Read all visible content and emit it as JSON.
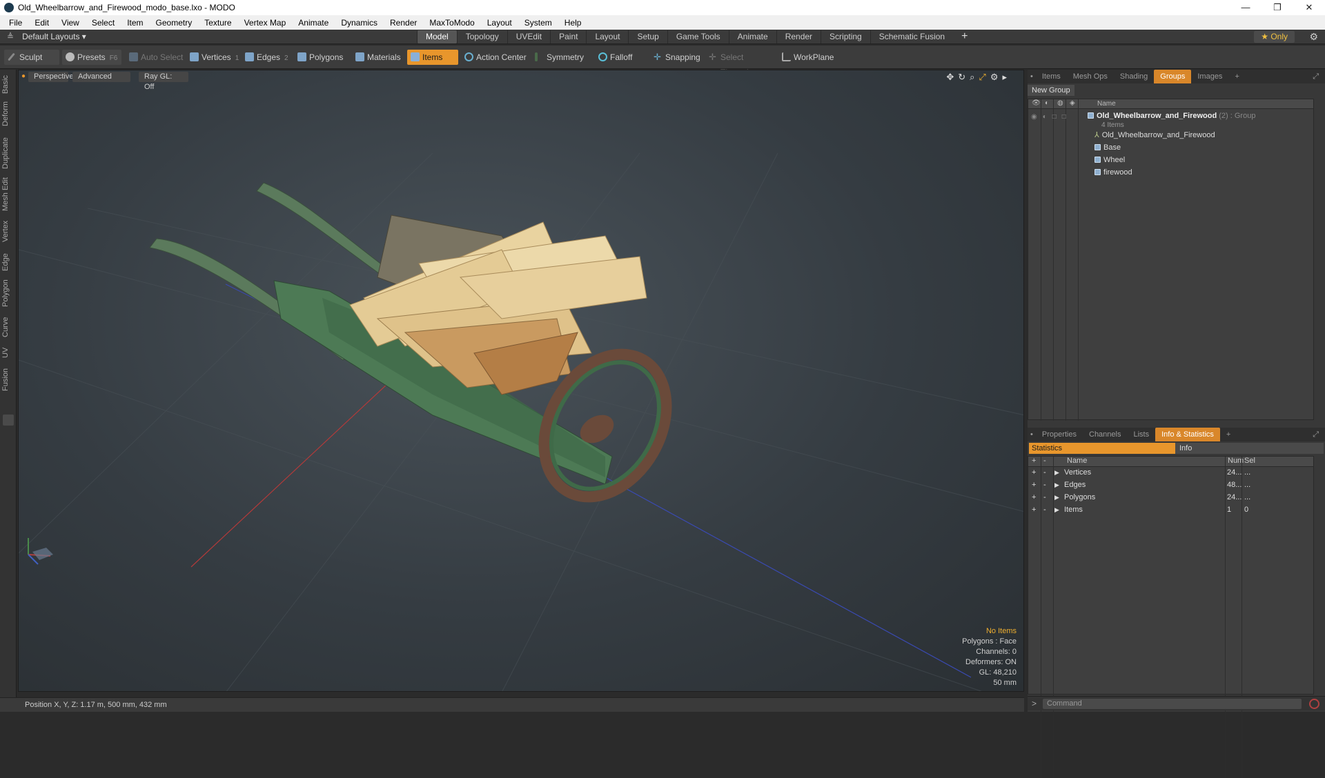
{
  "window": {
    "title": "Old_Wheelbarrow_and_Firewood_modo_base.lxo - MODO",
    "controls": [
      "—",
      "❐",
      "✕"
    ]
  },
  "menu": [
    "File",
    "Edit",
    "View",
    "Select",
    "Item",
    "Geometry",
    "Texture",
    "Vertex Map",
    "Animate",
    "Dynamics",
    "Render",
    "MaxToModo",
    "Layout",
    "System",
    "Help"
  ],
  "layout_bar": {
    "layout_select": "Default Layouts",
    "tabs": [
      "Model",
      "Topology",
      "UVEdit",
      "Paint",
      "Layout",
      "Setup",
      "Game Tools",
      "Animate",
      "Render",
      "Scripting",
      "Schematic Fusion"
    ],
    "active_tab": "Model",
    "add_tab": "+",
    "only_label": "★  Only"
  },
  "toolbar": {
    "sculpt": "Sculpt",
    "presets": "Presets",
    "presets_key": "F6",
    "auto_select": "Auto Select",
    "vertices": "Vertices",
    "vertices_key": "1",
    "edges": "Edges",
    "edges_key": "2",
    "polygons": "Polygons",
    "materials": "Materials",
    "items": "Items",
    "action_center": "Action Center",
    "symmetry": "Symmetry",
    "falloff": "Falloff",
    "snapping": "Snapping",
    "select_through": "Select Through",
    "workplane": "WorkPlane"
  },
  "left_tabs": [
    "Basic",
    "Deform",
    "Duplicate",
    "Mesh Edit",
    "Vertex",
    "Edge",
    "Polygon",
    "Curve",
    "UV",
    "Fusion"
  ],
  "viewport": {
    "view_mode": "Perspective",
    "shading": "Advanced",
    "raygl": "Ray GL: Off",
    "hud": {
      "items": "No Items",
      "polygons": "Polygons : Face",
      "channels": "Channels: 0",
      "deformers": "Deformers: ON",
      "gl": "GL: 48,210",
      "scale": "50 mm"
    }
  },
  "status": {
    "position": "Position X, Y, Z:   1.17 m, 500 mm, 432 mm"
  },
  "groups_panel": {
    "tabs": [
      "Items",
      "Mesh Ops",
      "Shading",
      "Groups",
      "Images",
      "+"
    ],
    "active_tab": "Groups",
    "new_group": "New Group",
    "column_name": "Name",
    "root": {
      "name": "Old_Wheelbarrow_and_Firewood",
      "suffix": " (2) : Group",
      "count": "4 Items"
    },
    "children": [
      "Old_Wheelbarrow_and_Firewood",
      "Base",
      "Wheel",
      "firewood"
    ]
  },
  "stats_panel": {
    "tabs": [
      "Properties",
      "Channels",
      "Lists",
      "Info & Statistics",
      "+"
    ],
    "active_tab": "Info & Statistics",
    "sub_tabs": [
      "Statistics",
      "Info"
    ],
    "columns": [
      "Name",
      "Num",
      "Sel"
    ],
    "rows": [
      {
        "name": "Vertices",
        "num": "24...",
        "sel": "..."
      },
      {
        "name": "Edges",
        "num": "48...",
        "sel": "..."
      },
      {
        "name": "Polygons",
        "num": "24...",
        "sel": "..."
      },
      {
        "name": "Items",
        "num": "1",
        "sel": "0"
      }
    ]
  },
  "command": {
    "placeholder": "Command"
  }
}
